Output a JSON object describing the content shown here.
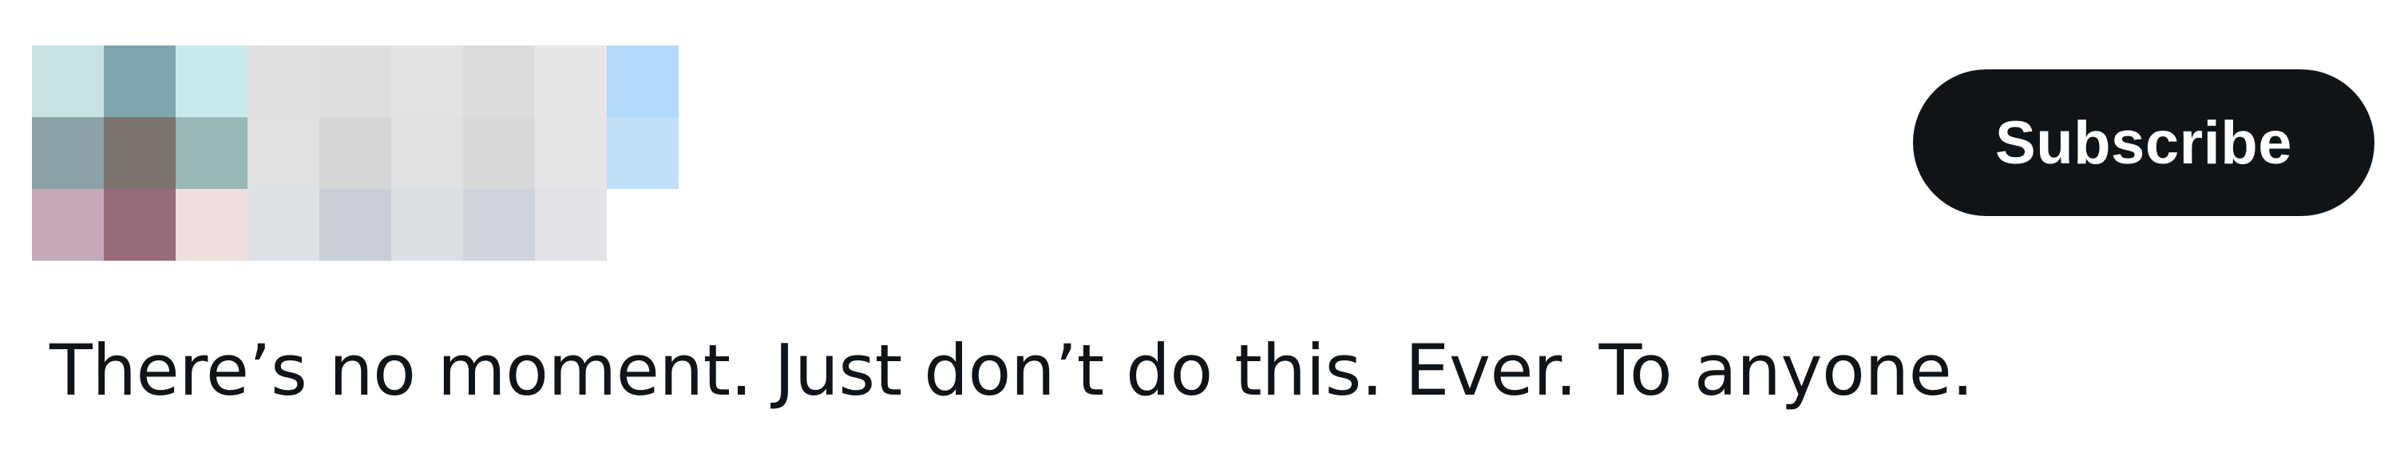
{
  "header": {
    "subscribe_label": "Subscribe"
  },
  "tweet": {
    "text": "There’s no moment. Just don’t do this. Ever. To anyone."
  },
  "redacted_avatar": {
    "rows": [
      [
        "#c8e3e4",
        "#7ea6ae",
        "#c8eaea",
        "#e0e0e0",
        "#dedede",
        "#e2e4e3",
        "#dcdcde",
        "#e7e7e9",
        "#b3d9fb"
      ],
      [
        "#8ba2a6",
        "#7b736c",
        "#99b8b8",
        "#e0e1e3",
        "#d6d7d9",
        "#e0e1e3",
        "#d9dadc",
        "#e6e6e8",
        "#c0e0fa"
      ],
      [
        "#c6aab9",
        "#986b7a",
        "#efdfdf",
        "#dde0e4",
        "#c9cfd5",
        "#dbdfe3",
        "#d1d5db",
        "#e1e3e6",
        "#ffffff"
      ]
    ]
  }
}
